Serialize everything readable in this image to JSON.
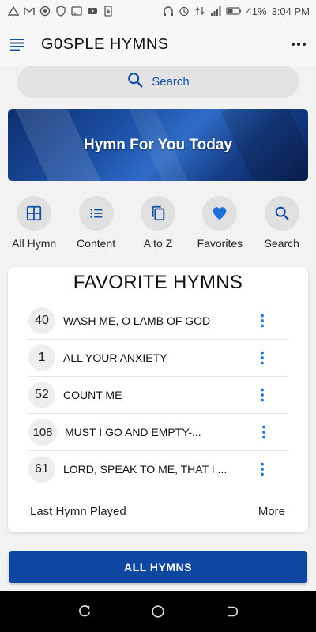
{
  "status_bar": {
    "battery": "41%",
    "time": "3:04 PM"
  },
  "app_bar": {
    "title": "G0SPLE HYMNS"
  },
  "search": {
    "label": "Search"
  },
  "hero": {
    "title": "Hymn For You Today"
  },
  "quick_actions": [
    {
      "label": "All Hymn",
      "icon": "grid-icon"
    },
    {
      "label": "Content",
      "icon": "list-icon"
    },
    {
      "label": "A to Z",
      "icon": "copy-icon"
    },
    {
      "label": "Favorites",
      "icon": "heart-icon"
    },
    {
      "label": "Search",
      "icon": "search-icon"
    }
  ],
  "favorites": {
    "title": "FAVORITE HYMNS",
    "items": [
      {
        "number": "40",
        "title": "WASH ME, O LAMB OF GOD"
      },
      {
        "number": "1",
        "title": "ALL YOUR ANXIETY"
      },
      {
        "number": "52",
        "title": "COUNT ME"
      },
      {
        "number": "108",
        "title": "MUST I GO AND EMPTY-..."
      },
      {
        "number": "61",
        "title": "LORD, SPEAK TO ME, THAT I ..."
      }
    ],
    "last_played_label": "Last Hymn Played",
    "more_label": "More"
  },
  "all_hymns_button": "ALL HYMNS",
  "colors": {
    "accent": "#1450a3",
    "button": "#0d47a1",
    "favorite": "#1e6fd8"
  }
}
